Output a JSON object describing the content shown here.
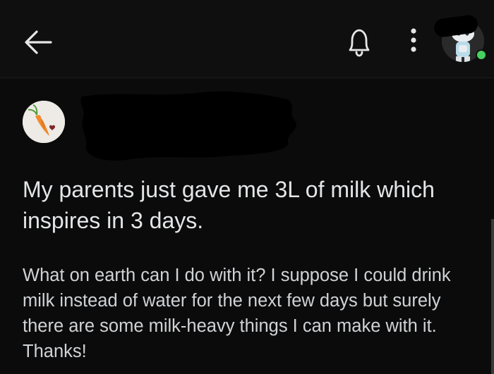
{
  "header": {
    "back_icon": "arrow-left-icon",
    "notifications_icon": "bell-icon",
    "more_icon": "more-vertical-icon",
    "user_status": "online",
    "status_color": "#46d160"
  },
  "post": {
    "author_avatar_icon": "carrot-avatar-icon",
    "title": "My parents just gave me 3L of milk which inspires in 3 days.",
    "body": "What on earth can I do with it? I suppose I could drink milk instead of water for the next few days but surely there are some milk-heavy things I can make with it. Thanks!"
  }
}
